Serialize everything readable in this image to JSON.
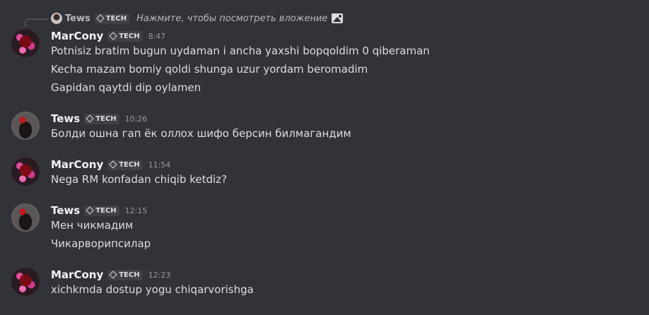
{
  "reply": {
    "author": "Tews",
    "tag": "TECH",
    "text": "Нажмите, чтобы посмотреть вложение",
    "attachment_icon": "image-icon"
  },
  "groups": [
    {
      "author": "MarCony",
      "tag": "TECH",
      "time": "8:47",
      "lines": [
        "Potnisiz bratim bugun uydaman i ancha yaxshi bopqoldim 0 qiberaman",
        "Kecha mazam bomiy qoldi shunga uzur yordam beromadim",
        "Gapidan qaytdi dip oylamen"
      ]
    },
    {
      "author": "Tews",
      "tag": "TECH",
      "time": "10:26",
      "lines": [
        "Болди ошна гап ёк оллох шифо берсин билмагандим"
      ]
    },
    {
      "author": "MarCony",
      "tag": "TECH",
      "time": "11:54",
      "lines": [
        "Nega RM konfadan chiqib ketdiz?"
      ]
    },
    {
      "author": "Tews",
      "tag": "TECH",
      "time": "12:15",
      "lines": [
        "Мен чикмадим",
        "Чикарворипсилар"
      ]
    },
    {
      "author": "MarCony",
      "tag": "TECH",
      "time": "12:23",
      "lines": [
        "xichkmda dostup yogu chiqarvorishga"
      ]
    }
  ]
}
